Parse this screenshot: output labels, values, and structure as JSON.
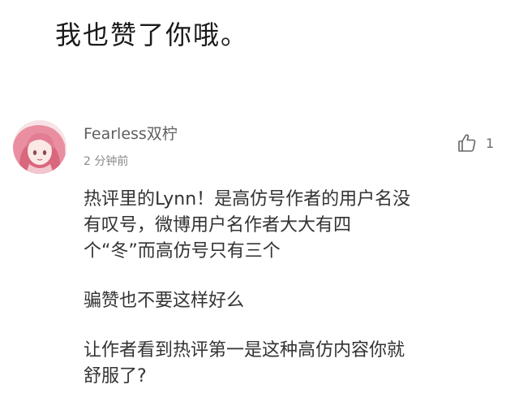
{
  "header": {
    "text": "我也赞了你哦。"
  },
  "comment": {
    "username": "Fearless双柠",
    "time": "2 分钟前",
    "like_count": "1",
    "like_icon": "thumbs-up-icon",
    "avatar_icon": "avatar-icon",
    "paragraphs": [
      "热评里的Lynn！是高仿号作者的用户名没\n有叹号，微博用户名作者大大有四\n个“冬”而高仿号只有三个",
      "骗赞也不要这样好么",
      "让作者看到热评第一是这种高仿内容你就\n舒服了?"
    ]
  },
  "colors": {
    "text_primary": "#333333",
    "text_secondary": "#8a8a8a",
    "avatar_bg": "#f6dfe3"
  }
}
